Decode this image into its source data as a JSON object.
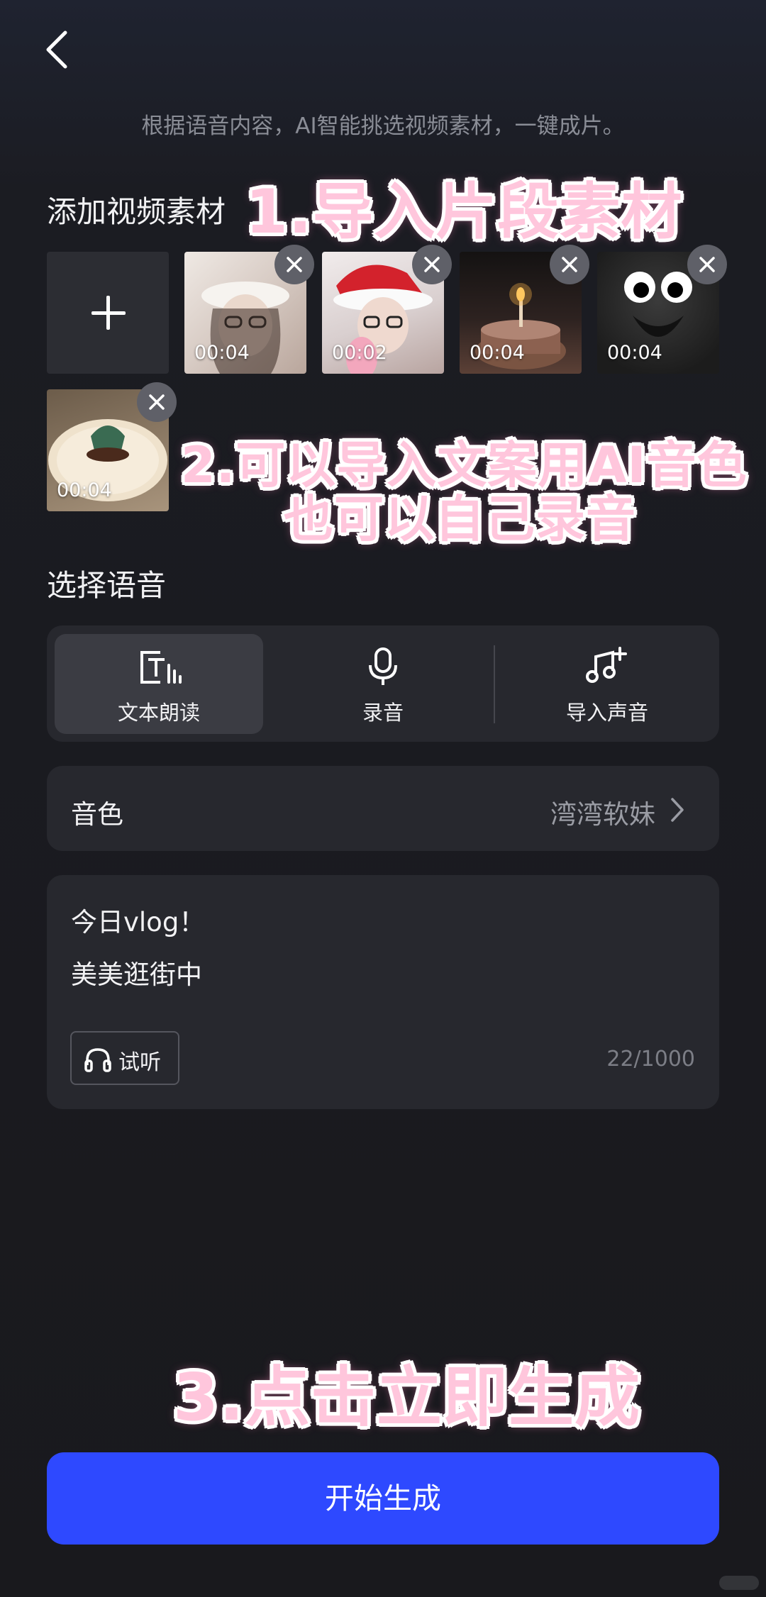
{
  "header": {
    "subtitle": "根据语音内容，AI智能挑选视频素材，一键成片。"
  },
  "annotations": {
    "step1": "1.导入片段素材",
    "step2_line1": "2.可以导入文案用AI音色",
    "step2_line2": "也可以自己录音",
    "step3": "3.点击立即生成"
  },
  "media": {
    "section_title": "添加视频素材",
    "clips": [
      {
        "duration": "00:04",
        "thumbnail_color": "#d8cfc8"
      },
      {
        "duration": "00:02",
        "thumbnail_color": "#e8dfe0"
      },
      {
        "duration": "00:04",
        "thumbnail_color": "#3a2a28"
      },
      {
        "duration": "00:04",
        "thumbnail_color": "#2a2a2a"
      },
      {
        "duration": "00:04",
        "thumbnail_color": "#c9b8a0"
      }
    ]
  },
  "voice": {
    "section_title": "选择语音",
    "options": [
      {
        "label": "文本朗读",
        "icon": "text-to-speech-icon",
        "selected": true
      },
      {
        "label": "录音",
        "icon": "microphone-icon",
        "selected": false
      },
      {
        "label": "导入声音",
        "icon": "add-music-icon",
        "selected": false
      }
    ],
    "timbre_label": "音色",
    "timbre_value": "湾湾软妹",
    "script_lines": [
      "今日vlog！",
      "美美逛街中"
    ],
    "listen_label": "试听",
    "char_count": "22/1000"
  },
  "cta": {
    "label": "开始生成",
    "color": "#2e49ff"
  },
  "colors": {
    "background": "#19191d",
    "card": "#27282e",
    "annotation_pink": "#ffc6dc"
  }
}
